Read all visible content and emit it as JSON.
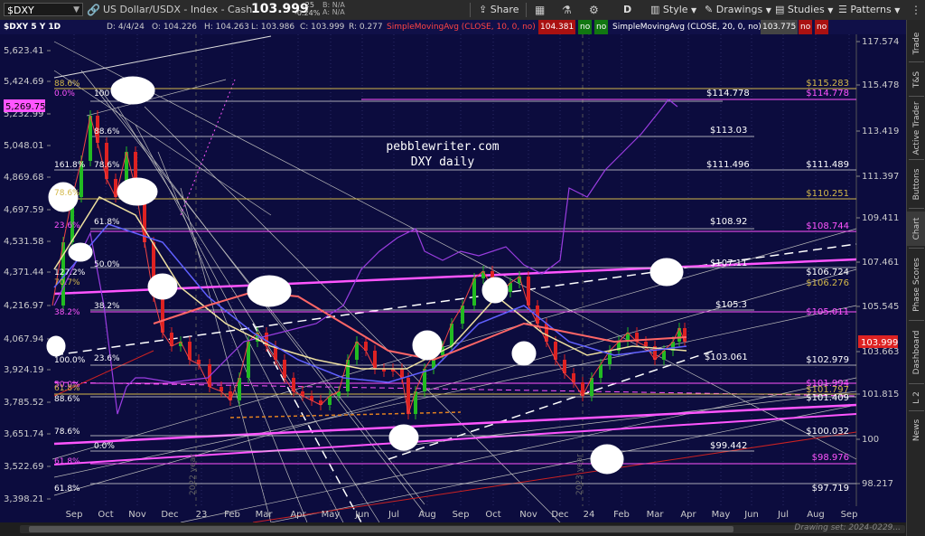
{
  "toolbar": {
    "symbol": "$DXY",
    "description": "US Dollar/USDX - Index - Cash",
    "last": "103.999",
    "change": "-.25",
    "change_pct": "-0.24%",
    "bid": "B: N/A",
    "ask": "A: N/A",
    "share": "Share",
    "period": "D",
    "style": "Style",
    "drawings": "Drawings",
    "studies": "Studies",
    "patterns": "Patterns"
  },
  "infobar": {
    "title": "$DXY 5 Y 1D",
    "date": "D: 4/4/24",
    "open": "O: 104.226",
    "high": "H: 104.263",
    "low": "L: 103.986",
    "close": "C: 103.999",
    "range": "R: 0.277",
    "sma10_label": "SimpleMovingAvg (CLOSE, 10, 0, no)",
    "sma10_value": "104.381",
    "sma10_no1": "no",
    "sma10_no2": "no",
    "sma20_label": "SimpleMovingAvg (CLOSE, 20, 0, no)",
    "sma20_value": "103.775",
    "sma20_no1": "no",
    "sma20_no2": "no"
  },
  "chart": {
    "watermark_line1": "pebblewriter.com",
    "watermark_line2": "DXY daily",
    "left_axis": [
      "5,623.41",
      "5,424.69",
      "5,232.99",
      "5,048.01",
      "4,869.68",
      "4,697.59",
      "4,531.58",
      "4,371.44",
      "4,216.97",
      "4,067.94",
      "3,924.19",
      "3,785.52",
      "3,651.74",
      "3,522.69",
      "3,398.21"
    ],
    "left_marker": "5,269.75",
    "right_axis": [
      "117.574",
      "115.478",
      "113.419",
      "111.397",
      "109.411",
      "107.461",
      "105.545",
      "103.663",
      "101.815",
      "100",
      "98.217"
    ],
    "right_marker": "103.999",
    "x_labels": [
      "Sep",
      "Oct",
      "Nov",
      "Dec",
      "23",
      "Feb",
      "Mar",
      "Apr",
      "May",
      "Jun",
      "Jul",
      "Aug",
      "Sep",
      "Oct",
      "Nov",
      "Dec",
      "24",
      "Feb",
      "Mar",
      "Apr",
      "May",
      "Jun",
      "Jul",
      "Aug",
      "Sep"
    ],
    "year_tag_2022": "2022 year",
    "year_tag_2023": "2023 year",
    "levels_left": [
      "88.6%",
      "0.0%",
      "100",
      "88.6%",
      "161.8%",
      "78.6%",
      "78.6%",
      "23.6%",
      "61.8%",
      "50.0%",
      "127.2%",
      "70.7%",
      "38.2%",
      "38.2%",
      "100.0%",
      "23.6%",
      "50.0%",
      "61.8%",
      "88.6%",
      "78.6%",
      "0.0%",
      "61.8%",
      "61.8%"
    ],
    "levels_mid": [
      "$114.778",
      "$113.03",
      "$111.496",
      "$108.92",
      "$107.11",
      "$105.3",
      "$103.061",
      "$99.442"
    ],
    "levels_right_white": [
      "$111.489",
      "$106.724",
      "$102.979",
      "$101.409",
      "$100.032",
      "$97.719"
    ],
    "levels_right_pink": [
      "$114.778",
      "$108.744",
      "$105.011",
      "$101.994",
      "$98.976"
    ],
    "levels_right_gold": [
      "$115.283",
      "$110.251",
      "$106.276",
      "$101.797"
    ]
  },
  "right_tabs": [
    "Trade",
    "T&S",
    "Active Trader",
    "Buttons",
    "Chart",
    "Phase Scores",
    "Dashboard",
    "L 2",
    "News"
  ],
  "status": {
    "drawing_set": "Drawing set: 2024-0229..."
  },
  "colors": {
    "chart_bg": "#0c0c3e",
    "grid": "#2a2a66",
    "pink": "#ff55ff",
    "gold": "#d4b94a",
    "up_candle": "#22bb22",
    "down_candle": "#dd2222"
  }
}
